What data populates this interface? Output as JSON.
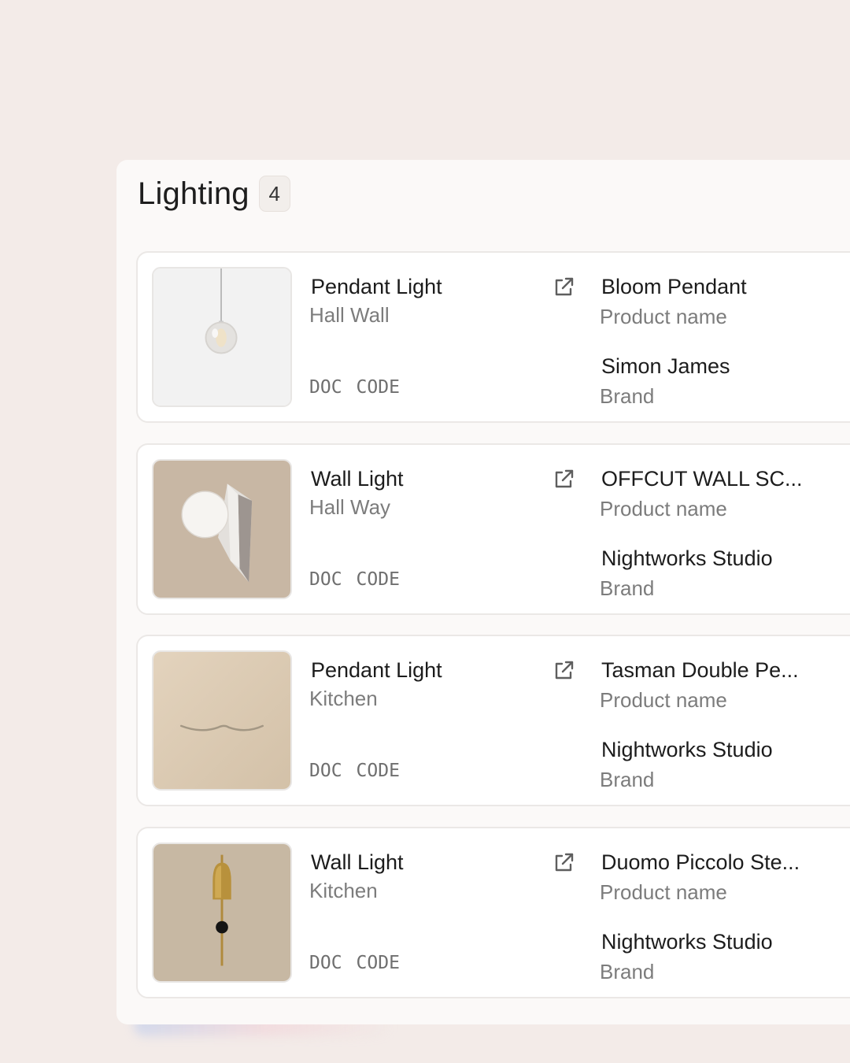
{
  "section": {
    "title": "Lighting",
    "count": "4"
  },
  "items": [
    {
      "type": "Pendant Light",
      "location": "Hall Wall",
      "doc_label": "DOC",
      "code_label": "CODE",
      "product_name": "Bloom Pendant",
      "product_label": "Product name",
      "brand": "Simon James",
      "brand_label": "Brand"
    },
    {
      "type": "Wall Light",
      "location": "Hall Way",
      "doc_label": "DOC",
      "code_label": "CODE",
      "product_name": "OFFCUT WALL SC...",
      "product_label": "Product name",
      "brand": "Nightworks Studio",
      "brand_label": "Brand"
    },
    {
      "type": "Pendant Light",
      "location": "Kitchen",
      "doc_label": "DOC",
      "code_label": "CODE",
      "product_name": "Tasman Double Pe...",
      "product_label": "Product name",
      "brand": "Nightworks Studio",
      "brand_label": "Brand"
    },
    {
      "type": "Wall Light",
      "location": "Kitchen",
      "doc_label": "DOC",
      "code_label": "CODE",
      "product_name": "Duomo Piccolo Ste...",
      "product_label": "Product name",
      "brand": "Nightworks Studio",
      "brand_label": "Brand"
    }
  ]
}
